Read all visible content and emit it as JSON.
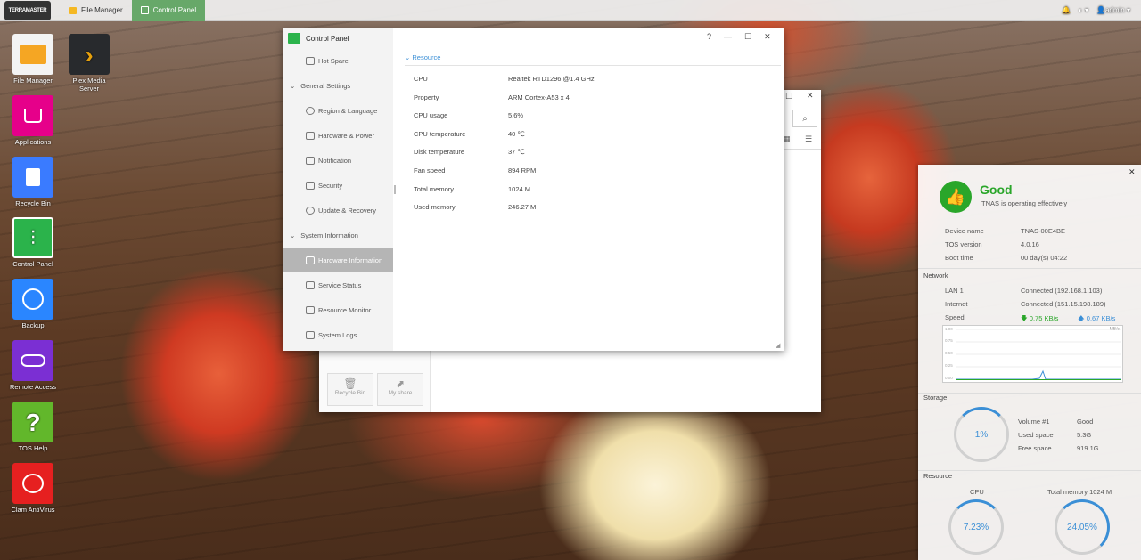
{
  "topbar": {
    "logo": "TERRAMASTER",
    "tabs": [
      {
        "label": "File Manager"
      },
      {
        "label": "Control Panel"
      }
    ],
    "user": "admin"
  },
  "desktop": {
    "icons": [
      {
        "label": "File Manager",
        "color": "#f5a623"
      },
      {
        "label": "Plex Media Server",
        "color": "#282a2d"
      },
      {
        "label": "Applications",
        "color": "#e6008a"
      },
      {
        "label": "Recycle Bin",
        "color": "#3a7bff"
      },
      {
        "label": "Control Panel",
        "color": "#2bb34b"
      },
      {
        "label": "Backup",
        "color": "#2a86ff"
      },
      {
        "label": "Remote Access",
        "color": "#7b2fd3"
      },
      {
        "label": "TOS Help",
        "color": "#62b72b"
      },
      {
        "label": "Clam AntiVirus",
        "color": "#e62020"
      }
    ]
  },
  "file_manager": {
    "footer_buttons": [
      {
        "label": "Recycle Bin"
      },
      {
        "label": "My share"
      }
    ]
  },
  "control_panel": {
    "title": "Control Panel",
    "window_controls": {
      "help": "?",
      "minimize": "—",
      "maximize": "☐",
      "close": "✕"
    },
    "nav": [
      {
        "type": "item",
        "label": "Hot Spare"
      },
      {
        "type": "group",
        "label": "General Settings"
      },
      {
        "type": "item",
        "label": "Region & Language"
      },
      {
        "type": "item",
        "label": "Hardware & Power"
      },
      {
        "type": "item",
        "label": "Notification"
      },
      {
        "type": "item",
        "label": "Security"
      },
      {
        "type": "item",
        "label": "Update & Recovery"
      },
      {
        "type": "group",
        "label": "System Information"
      },
      {
        "type": "item",
        "label": "Hardware Information",
        "selected": true
      },
      {
        "type": "item",
        "label": "Service Status"
      },
      {
        "type": "item",
        "label": "Resource Monitor"
      },
      {
        "type": "item",
        "label": "System Logs"
      }
    ],
    "section_title": "Resource",
    "rows": [
      {
        "label": "CPU",
        "value": "Realtek RTD1296 @1.4 GHz"
      },
      {
        "label": "Property",
        "value": "ARM Cortex-A53 x 4"
      },
      {
        "label": "CPU usage",
        "value": "5.6%"
      },
      {
        "label": "CPU temperature",
        "value": "40 ℃"
      },
      {
        "label": "Disk temperature",
        "value": "37 ℃"
      },
      {
        "label": "Fan speed",
        "value": "894 RPM"
      },
      {
        "label": "Total memory",
        "value": "1024 M"
      },
      {
        "label": "Used memory",
        "value": "246.27 M"
      }
    ]
  },
  "status_panel": {
    "status": "Good",
    "status_text": "TNAS is operating effectively",
    "device": [
      {
        "label": "Device name",
        "value": "TNAS-00E4BE"
      },
      {
        "label": "TOS version",
        "value": "4.0.16"
      },
      {
        "label": "Boot time",
        "value": "00 day(s) 04:22"
      }
    ],
    "network_title": "Network",
    "network": [
      {
        "label": "LAN 1",
        "value": "Connected (192.168.1.103)"
      },
      {
        "label": "Internet",
        "value": "Connected (151.15.198.189)"
      }
    ],
    "speed_label": "Speed",
    "download": "0.75 KB/s",
    "upload": "0.67 KB/s",
    "chart_unit": "MB/s",
    "chart_yticks": [
      "1.00",
      "0.75",
      "0.50",
      "0.25",
      "0.00"
    ],
    "storage_title": "Storage",
    "storage_percent": "1%",
    "storage_fraction": 0.01,
    "storage": [
      {
        "label": "Volume #1",
        "value": "Good"
      },
      {
        "label": "Used space",
        "value": "5.3G"
      },
      {
        "label": "Free space",
        "value": "919.1G"
      }
    ],
    "resource_title": "Resource",
    "cpu_label": "CPU",
    "cpu_percent": "7.23%",
    "cpu_fraction": 0.0723,
    "mem_label": "Total memory 1024 M",
    "mem_percent": "24.05%",
    "mem_fraction": 0.2405,
    "accent": "#3b8fd6",
    "good_color": "#2aa62a"
  }
}
